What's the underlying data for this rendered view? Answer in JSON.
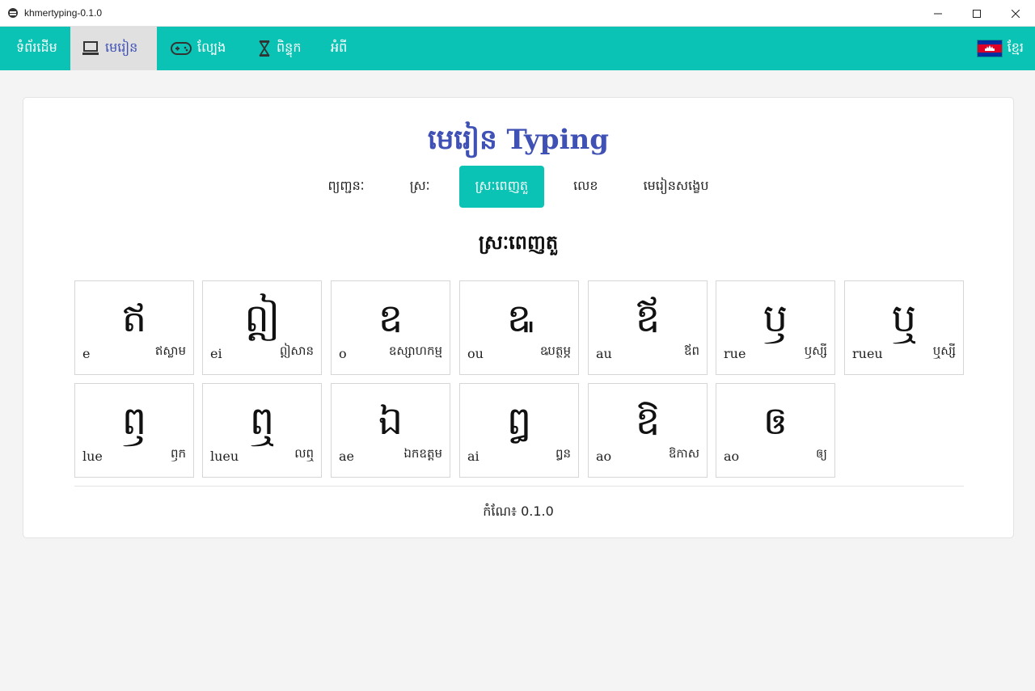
{
  "window": {
    "title": "khmertyping-0.1.0"
  },
  "nav": {
    "items": [
      {
        "label": "ទំព័រដើម",
        "icon": ""
      },
      {
        "label": "មេរៀន",
        "icon": "laptop-icon"
      },
      {
        "label": "ល្បែង",
        "icon": "gamepad-icon"
      },
      {
        "label": "ពិន្ទុក",
        "icon": "hourglass-icon"
      },
      {
        "label": "អំពី",
        "icon": ""
      }
    ],
    "active_index": 1,
    "language": "ខ្មែរ"
  },
  "page": {
    "title": "មេរៀន Typing",
    "tabs": [
      "ព្យញ្ជនៈ",
      "ស្រៈ",
      "ស្រៈពេញតួ",
      "លេខ",
      "មេរៀនសង្ខេប"
    ],
    "active_tab": 2,
    "section_title": "ស្រៈពេញតួ",
    "keys": [
      {
        "glyph": "ឥ",
        "roman": "e",
        "example": "ឥស្លាម"
      },
      {
        "glyph": "ឦ",
        "roman": "ei",
        "example": "ឦសាន"
      },
      {
        "glyph": "ឧ",
        "roman": "o",
        "example": "ឧស្សាហកម្ម"
      },
      {
        "glyph": "ឩ",
        "roman": "ou",
        "example": "ឩបត្ថម្ភ"
      },
      {
        "glyph": "ឪ",
        "roman": "au",
        "example": "ឪព"
      },
      {
        "glyph": "ឫ",
        "roman": "rue",
        "example": "ឫស្សី"
      },
      {
        "glyph": "ឬ",
        "roman": "rueu",
        "example": "ឬស្សី"
      },
      {
        "glyph": "ឭ",
        "roman": "lue",
        "example": "ឭក"
      },
      {
        "glyph": "ឮ",
        "roman": "lueu",
        "example": "លឮ"
      },
      {
        "glyph": "ឯ",
        "roman": "ae",
        "example": "ឯកឧត្តម"
      },
      {
        "glyph": "ឰ",
        "roman": "ai",
        "example": "ឰន"
      },
      {
        "glyph": "ឱ",
        "roman": "ao",
        "example": "ឱកាស"
      },
      {
        "glyph": "ឲ",
        "roman": "ao",
        "example": "ឲ្យ"
      }
    ],
    "version": "កំណែ៖ 0.1.0"
  },
  "colors": {
    "primary": "#0bc3b4",
    "accent": "#3f51b5"
  }
}
